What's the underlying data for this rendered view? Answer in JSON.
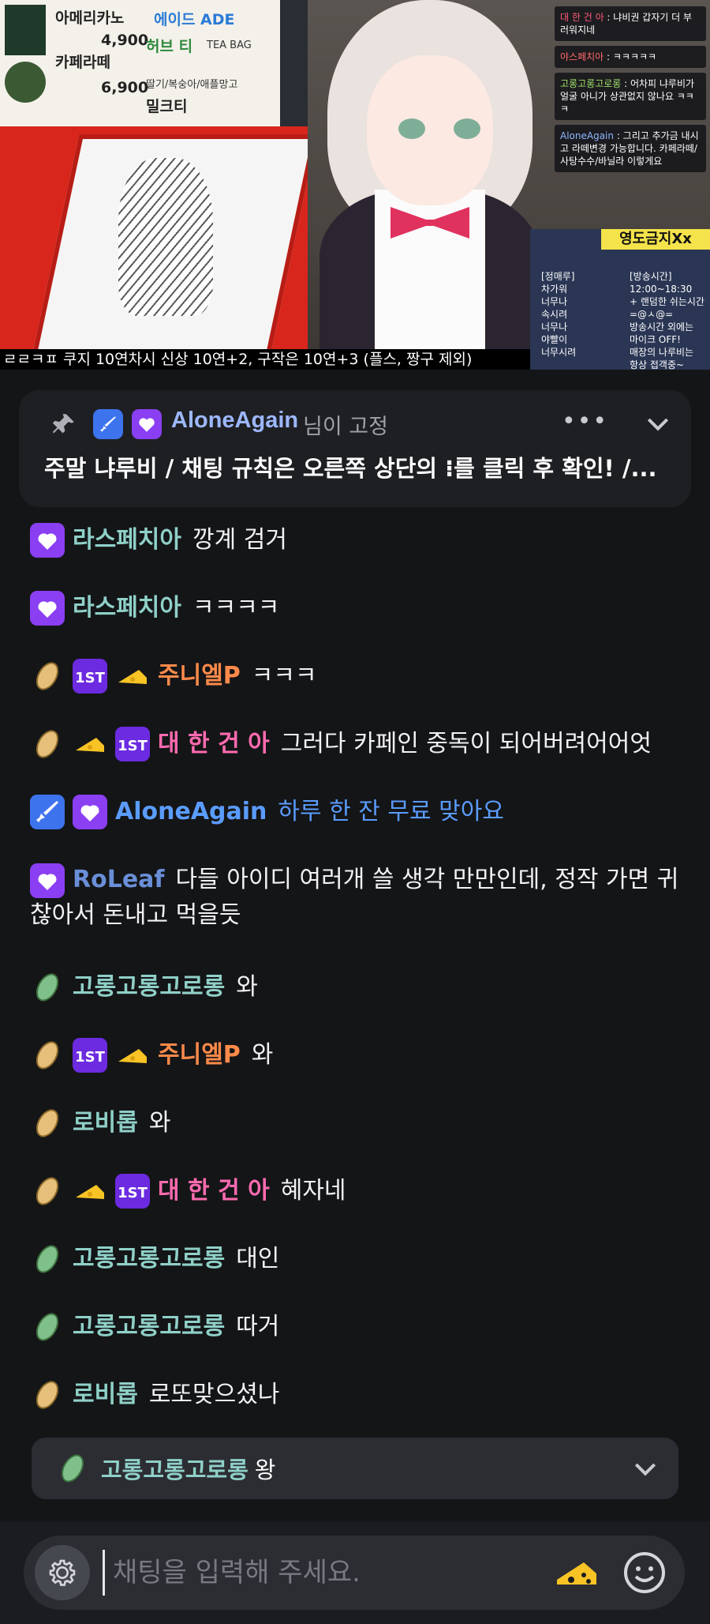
{
  "stream": {
    "menu": {
      "item1": "아메리카노",
      "price1": "4,900",
      "item2": "카페라떼",
      "price2": "6,900",
      "item3": "에이드 ADE",
      "item4": "허브 티",
      "item4_sub": "TEA BAG",
      "item5": "딸기/복숭아/애플망고",
      "item6": "밀크티"
    },
    "overlay_chat": [
      {
        "name": "대 한 건 아",
        "text": "냐비권 갑자기 더 부러워지네"
      },
      {
        "name": "야스페치아",
        "text": "ㅋㅋㅋㅋㅋ"
      },
      {
        "name": "고롱고롱고로롱",
        "text": "어차피 냐루비가 얼굴 아니가 상관없지 않나요 ㅋㅋㅋ"
      },
      {
        "name": "AloneAgain",
        "text": "그리고 추가금 내시고 라떼변경 가능합니다. 카페라떼/사탕수수/바닐라 이렇게요"
      }
    ],
    "schedule": {
      "title": "영도금지Xx",
      "left_lines": [
        "[정매루]",
        "차가워",
        "너무나",
        "속시려",
        "너무나",
        "야빨이",
        "너무시려"
      ],
      "right_lines": [
        "[방송시간]",
        "12:00~18:30",
        "+ 랜덤한 쉬는시간",
        "=@ㅅ@=",
        "방송시간 외에는",
        "마이크 OFF!",
        "매장의 나루비는",
        "항상 접객중~"
      ]
    },
    "ticker": "ㄹㄹㅋㅍ 쿠지 10연차시 신상 10연+2, 구작은 10연+3 (플스, 짱구 제외)"
  },
  "pinned": {
    "name": "AloneAgain",
    "suffix": "님이 고정",
    "text": "주말 냐루비 / 채팅 규칙은 오른쪽 상단의 ⁝를 클릭 후 확인!  /..."
  },
  "chat": [
    {
      "name": "라스페치아",
      "message": "깡계 검거"
    },
    {
      "name": "라스페치아",
      "message": "ㅋㅋㅋㅋ"
    },
    {
      "name": "주니엘P",
      "message": "ㅋㅋㅋ"
    },
    {
      "name": "대 한 건 아",
      "message": "그러다 카페인 중독이 되어버려어어엇"
    },
    {
      "name": "AloneAgain",
      "message": "하루 한 잔 무료 맞아요"
    },
    {
      "name": "RoLeaf",
      "message": "다들 아이디 여러개 쓸 생각 만만인데, 정작 가면 귀찮아서 돈내고 먹을듯"
    },
    {
      "name": "고롱고롱고로롱",
      "message": "와"
    },
    {
      "name": "주니엘P",
      "message": "와"
    },
    {
      "name": "로비롭",
      "message": "와"
    },
    {
      "name": "대 한 건 아",
      "message": "혜자네"
    },
    {
      "name": "고롱고롱고로롱",
      "message": "대인"
    },
    {
      "name": "고롱고롱고로롱",
      "message": "따거"
    },
    {
      "name": "로비롭",
      "message": "로또맞으셨나"
    }
  ],
  "preview": {
    "name": "고롱고롱고로롱",
    "message": "왕"
  },
  "input": {
    "placeholder": "채팅을 입력해 주세요."
  },
  "colors": {
    "background": "#141517",
    "pinned_bg": "#1e1f23",
    "name_teal": "#8fd0c8",
    "name_pink": "#ff6bb0",
    "name_orange": "#ff8a4a",
    "name_blue": "#5a9cff",
    "accent_purple": "#8a3ff2",
    "accent_blue": "#3d74ee",
    "cheese_yellow": "#f7c325"
  }
}
